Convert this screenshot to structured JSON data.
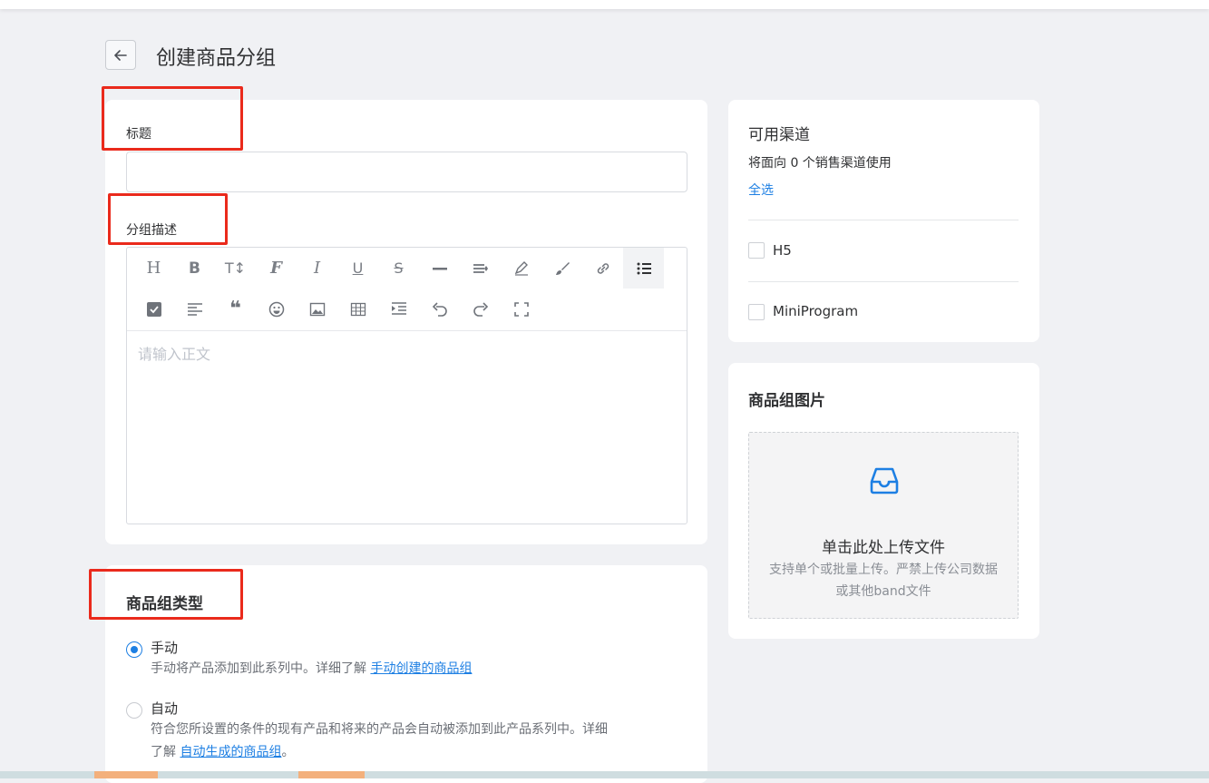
{
  "page": {
    "title": "创建商品分组"
  },
  "form": {
    "title_label": "标题",
    "title_value": "",
    "desc_label": "分组描述",
    "editor_placeholder": "请输入正文",
    "toolbar_row1": [
      {
        "icon": "heading-icon",
        "glyph": "H"
      },
      {
        "icon": "bold-icon",
        "glyph": "B"
      },
      {
        "icon": "font-size-icon",
        "glyph": "T↕"
      },
      {
        "icon": "font-family-icon",
        "glyph": "F"
      },
      {
        "icon": "italic-icon",
        "glyph": "I"
      },
      {
        "icon": "underline-icon",
        "glyph": "U"
      },
      {
        "icon": "strikethrough-icon",
        "glyph": "S"
      },
      {
        "icon": "horizontal-rule-icon",
        "glyph": "—"
      },
      {
        "icon": "line-height-icon",
        "glyph": "≡"
      },
      {
        "icon": "highlight-icon",
        "glyph": "✎"
      },
      {
        "icon": "brush-icon",
        "glyph": "🖌"
      },
      {
        "icon": "link-icon",
        "glyph": "🔗"
      },
      {
        "icon": "bullet-list-icon",
        "glyph": "☰"
      }
    ],
    "toolbar_row2": [
      {
        "icon": "task-list-icon",
        "glyph": "☑"
      },
      {
        "icon": "align-left-icon",
        "glyph": "≡"
      },
      {
        "icon": "quote-icon",
        "glyph": "❝"
      },
      {
        "icon": "emoji-icon",
        "glyph": "☺"
      },
      {
        "icon": "image-icon",
        "glyph": "▣"
      },
      {
        "icon": "table-icon",
        "glyph": "⊞"
      },
      {
        "icon": "indent-icon",
        "glyph": "⇥"
      },
      {
        "icon": "undo-icon",
        "glyph": "↶"
      },
      {
        "icon": "redo-icon",
        "glyph": "↷"
      },
      {
        "icon": "fullscreen-icon",
        "glyph": "⛶"
      }
    ]
  },
  "group_type": {
    "title": "商品组类型",
    "options": [
      {
        "label": "手动",
        "desc_prefix": "手动将产品添加到此系列中。详细了解 ",
        "link": "手动创建的商品组",
        "desc_suffix": "",
        "checked": true
      },
      {
        "label": "自动",
        "desc_line1": "符合您所设置的条件的现有产品和将来的产品会自动被添加到此产品系列中。详细",
        "desc_prefix": "了解 ",
        "link": "自动生成的商品组",
        "desc_suffix": "。",
        "checked": false
      }
    ]
  },
  "channels": {
    "title": "可用渠道",
    "subtitle": "将面向 0 个销售渠道使用",
    "select_all": "全选",
    "items": [
      {
        "label": "H5",
        "checked": false
      },
      {
        "label": "MiniProgram",
        "checked": false
      }
    ]
  },
  "image": {
    "title": "商品组图片",
    "upload_title": "单击此处上传文件",
    "upload_desc": "支持单个或批量上传。严禁上传公司数据或其他band文件",
    "accent": "#1d7fe3"
  }
}
